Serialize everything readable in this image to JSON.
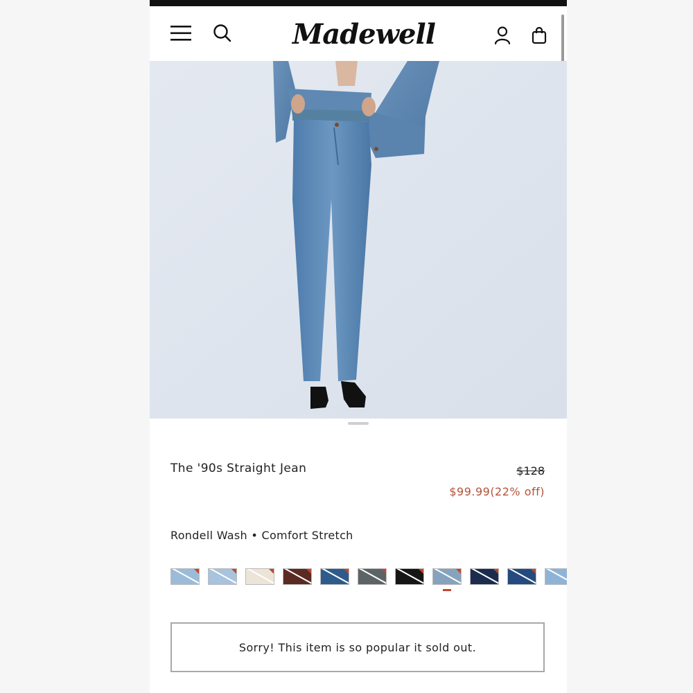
{
  "header": {
    "logo_text": "Madewell",
    "icons": [
      "menu-icon",
      "search-icon",
      "account-icon",
      "bag-icon"
    ]
  },
  "product": {
    "title": "The '90s Straight Jean",
    "original_price": "$128",
    "sale_price": "$99.99(22% off)",
    "variant": "Rondell Wash • Comfort Stretch"
  },
  "swatches": [
    {
      "color": "#9bbbd8",
      "accent": "#c3452c"
    },
    {
      "color": "#a7c3dd",
      "accent": "#c3452c"
    },
    {
      "color": "#ece4d7",
      "accent": "#c3452c"
    },
    {
      "color": "#5b2a22",
      "accent": "#c3452c"
    },
    {
      "color": "#2e5b8c",
      "accent": "#c3452c"
    },
    {
      "color": "#5d6466",
      "accent": "#c3452c"
    },
    {
      "color": "#161616",
      "accent": "#c3452c"
    },
    {
      "color": "#86a3be",
      "accent": "#c3452c",
      "selected": true
    },
    {
      "color": "#1c2c4f",
      "accent": "#c3452c"
    },
    {
      "color": "#244a7f",
      "accent": "#c3452c"
    },
    {
      "color": "#8fb3d6",
      "accent": "#c3452c"
    }
  ],
  "status": {
    "sold_out_message": "Sorry! This item is so popular it sold out."
  },
  "colors": {
    "sale": "#b4533a",
    "accent": "#c3452c",
    "hero_background": "#dfe5ee"
  }
}
